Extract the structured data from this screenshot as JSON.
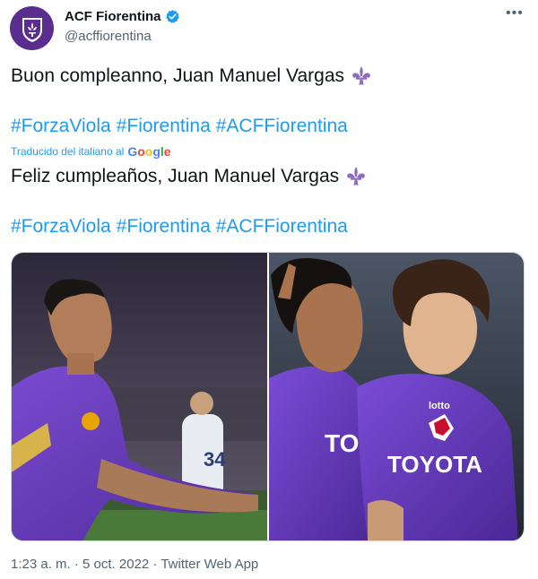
{
  "account": {
    "display_name": "ACF Fiorentina",
    "handle": "@acffiorentina",
    "avatar_icon": "fiorentina-crest-icon",
    "verified_icon": "verified-badge-icon"
  },
  "tweet": {
    "original_text": "Buon compleanno, Juan Manuel Vargas",
    "hashtags": [
      "#ForzaViola",
      "#Fiorentina",
      "#ACFFiorentina"
    ],
    "translated_label": "Traducido del italiano al",
    "translator": "Google",
    "translated_text": "Feliz cumpleaños, Juan Manuel Vargas",
    "translated_hashtags": [
      "#ForzaViola",
      "#Fiorentina",
      "#ACFFiorentina"
    ]
  },
  "media": {
    "photo_count": 2,
    "jersey_text_left": "TOYO",
    "jersey_text_right": "TOYOTA",
    "jersey_brand": "lotto",
    "player_number": "34"
  },
  "footer": {
    "timestamp": "1:23 a. m. · 5 oct. 2022 · Twitter Web App"
  },
  "colors": {
    "link": "#1d9bf0",
    "fiorentina_purple": "#5b2d8e",
    "fleur_lilac": "#8c6bc0",
    "secondary_text": "#536471"
  }
}
